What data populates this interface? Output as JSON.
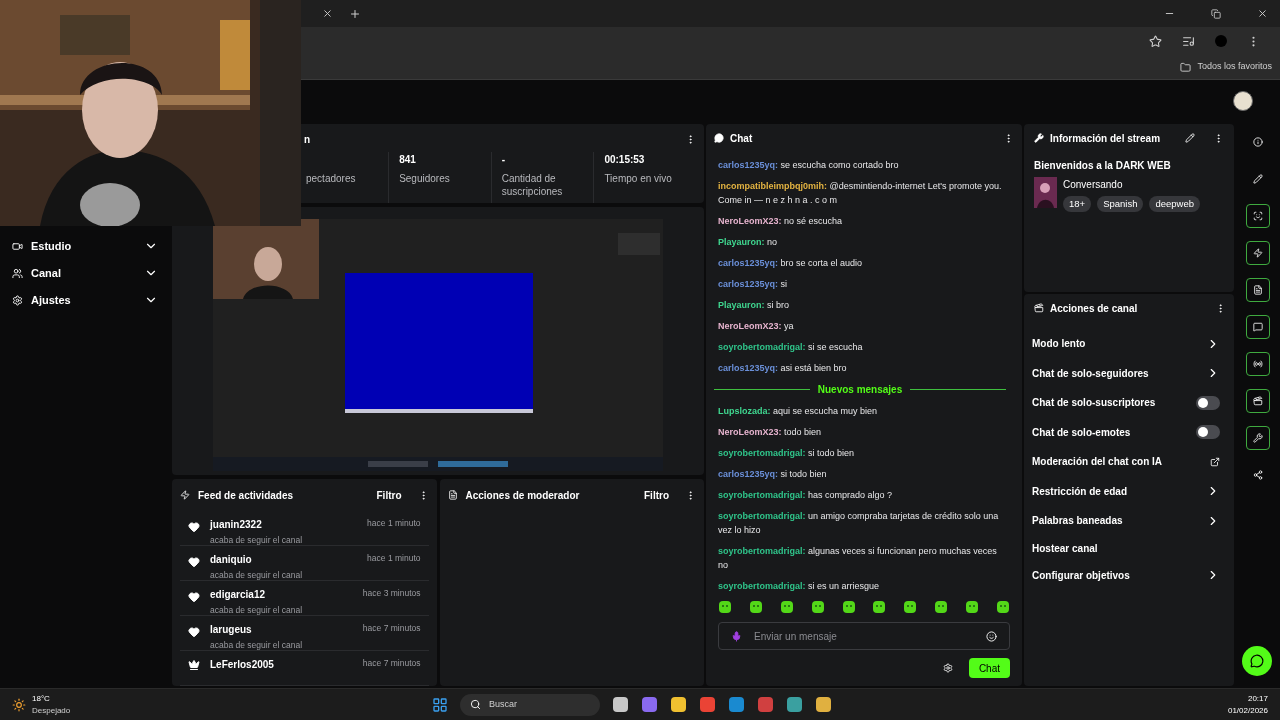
{
  "browser": {
    "bookmarks_folder": "Todos los favoritos"
  },
  "sidebar": {
    "items": [
      {
        "label": "Estudio"
      },
      {
        "label": "Canal"
      },
      {
        "label": "Ajustes"
      }
    ]
  },
  "stats": {
    "title_fragment": "n",
    "items": [
      {
        "label": "pectadores"
      },
      {
        "value": "841",
        "label": "Seguidores"
      },
      {
        "value": "-",
        "label": "Cantidad de suscripciones"
      },
      {
        "value": "00:15:53",
        "label": "Tiempo en vivo"
      }
    ]
  },
  "feed": {
    "title": "Feed de actividades",
    "filter": "Filtro",
    "items": [
      {
        "kind": "follow",
        "user": "juanin2322",
        "text": "acaba de seguir el canal",
        "time": "hace 1 minuto"
      },
      {
        "kind": "follow",
        "user": "daniquio",
        "text": "acaba de seguir el canal",
        "time": "hace 1 minuto"
      },
      {
        "kind": "follow",
        "user": "edigarcia12",
        "text": "acaba de seguir el canal",
        "time": "hace 3 minutos"
      },
      {
        "kind": "follow",
        "user": "larugeus",
        "text": "acaba de seguir el canal",
        "time": "hace 7 minutos"
      },
      {
        "kind": "subscribe",
        "user": "LeFerlos2005",
        "time": "hace 7 minutos"
      }
    ]
  },
  "mod_actions": {
    "title": "Acciones de moderador",
    "filter": "Filtro"
  },
  "chat": {
    "title": "Chat",
    "messages": [
      {
        "user": "carlos1235yq:",
        "color": "#6a8fd8",
        "text": "se escucha como cortado bro"
      },
      {
        "user": "incompatibleimpbqj0mih:",
        "color": "#e3b341",
        "text": "@desmintiendo-internet Let's promote you. Come in — n e z h n a  . c o m"
      },
      {
        "user": "NeroLeomX23:",
        "color": "#e7b4cf",
        "text": "no sé escucha"
      },
      {
        "user": "Playauron:",
        "color": "#3fd68f",
        "text": "no"
      },
      {
        "user": "carlos1235yq:",
        "color": "#6a8fd8",
        "text": "bro se corta el audio"
      },
      {
        "user": "carlos1235yq:",
        "color": "#6a8fd8",
        "text": "si"
      },
      {
        "user": "Playauron:",
        "color": "#3fd68f",
        "text": "si bro"
      },
      {
        "user": "NeroLeomX23:",
        "color": "#e7b4cf",
        "text": "ya"
      },
      {
        "user": "soyrobertomadrigal:",
        "color": "#2fc48a",
        "text": "si se escucha"
      },
      {
        "user": "carlos1235yq:",
        "color": "#6a8fd8",
        "text": "asi está bien bro"
      },
      {
        "kind": "divider",
        "text": "Nuevos mensajes"
      },
      {
        "user": "Lupslozada:",
        "color": "#3fd68f",
        "text": "aqui se escucha muy bien"
      },
      {
        "user": "NeroLeomX23:",
        "color": "#e7b4cf",
        "text": "todo bien"
      },
      {
        "user": "soyrobertomadrigal:",
        "color": "#2fc48a",
        "text": "si todo bien"
      },
      {
        "user": "carlos1235yq:",
        "color": "#6a8fd8",
        "text": "si todo bien"
      },
      {
        "user": "soyrobertomadrigal:",
        "color": "#2fc48a",
        "text": "has comprado algo ?"
      },
      {
        "user": "soyrobertomadrigal:",
        "color": "#2fc48a",
        "text": "un amigo compraba tarjetas de crédito solo una vez lo hizo"
      },
      {
        "user": "soyrobertomadrigal:",
        "color": "#2fc48a",
        "text": "algunas veces si funcionan pero muchas veces no"
      },
      {
        "user": "soyrobertomadrigal:",
        "color": "#2fc48a",
        "text": "si es un arriesgue"
      }
    ],
    "emote_count_placeholder": "Enviar un mensaje",
    "send": "Chat"
  },
  "stream_info": {
    "title": "Información del stream",
    "stream_title": "Bienvenidos a la DARK WEB",
    "category": "Conversando",
    "tags": [
      "18+",
      "Spanish",
      "deepweb"
    ]
  },
  "channel_actions": {
    "title": "Acciones de canal",
    "items": [
      {
        "kind": "submenu",
        "label": "Modo lento"
      },
      {
        "kind": "submenu",
        "label": "Chat de solo-seguidores"
      },
      {
        "kind": "toggle",
        "label": "Chat de solo-suscriptores",
        "on": false
      },
      {
        "kind": "toggle",
        "label": "Chat de solo-emotes",
        "on": false
      },
      {
        "kind": "external",
        "label": "Moderación del chat con IA"
      },
      {
        "kind": "submenu",
        "label": "Restricción de edad"
      },
      {
        "kind": "submenu",
        "label": "Palabras baneadas"
      },
      {
        "kind": "plain",
        "label": "Hostear canal"
      },
      {
        "kind": "submenu",
        "label": "Configurar objetivos"
      }
    ]
  },
  "rail": [
    {
      "highlighted": false
    },
    {
      "highlighted": false
    },
    {
      "highlighted": true
    },
    {
      "highlighted": true
    },
    {
      "highlighted": true
    },
    {
      "highlighted": true
    },
    {
      "highlighted": true
    },
    {
      "highlighted": true
    },
    {
      "highlighted": true
    },
    {
      "highlighted": false
    }
  ],
  "taskbar": {
    "temperature": "18°C",
    "weather": "Despejado",
    "search": "Buscar",
    "time": "20:17",
    "date": "01/02/2026"
  }
}
